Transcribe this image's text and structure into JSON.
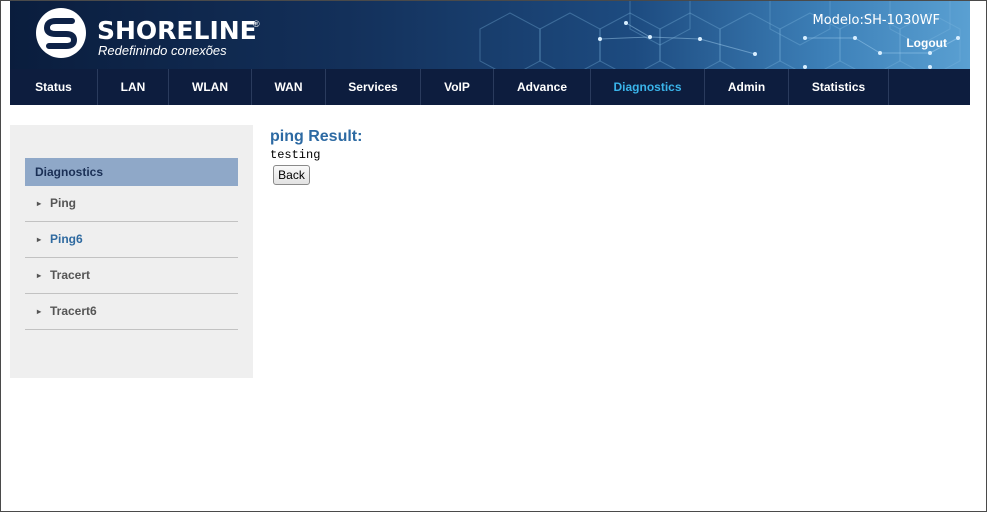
{
  "header": {
    "brand_name": "SHORELINE",
    "brand_mark": "®",
    "slogan": "Redefinindo conexões",
    "model": "Modelo:SH-1030WF",
    "logout_label": "Logout",
    "logo_icon": "shoreline-s-logo-icon"
  },
  "nav": {
    "items": [
      {
        "label": "Status"
      },
      {
        "label": "LAN"
      },
      {
        "label": "WLAN"
      },
      {
        "label": "WAN"
      },
      {
        "label": "Services"
      },
      {
        "label": "VoIP"
      },
      {
        "label": "Advance"
      },
      {
        "label": "Diagnostics"
      },
      {
        "label": "Admin"
      },
      {
        "label": "Statistics"
      }
    ],
    "active": "Diagnostics",
    "active_color": "#3ab4ea"
  },
  "sidebar": {
    "title": "Diagnostics",
    "items": [
      {
        "label": "Ping"
      },
      {
        "label": "Ping6"
      },
      {
        "label": "Tracert"
      },
      {
        "label": "Tracert6"
      }
    ],
    "active": "Ping6"
  },
  "main": {
    "title": "ping Result:",
    "output": "testing",
    "back_label": "Back"
  },
  "colors": {
    "header_dark": "#0a1d3d",
    "nav_bg": "#0d1d3e",
    "sidebar_head": "#8fa8c8",
    "title_blue": "#2d6aa3"
  }
}
